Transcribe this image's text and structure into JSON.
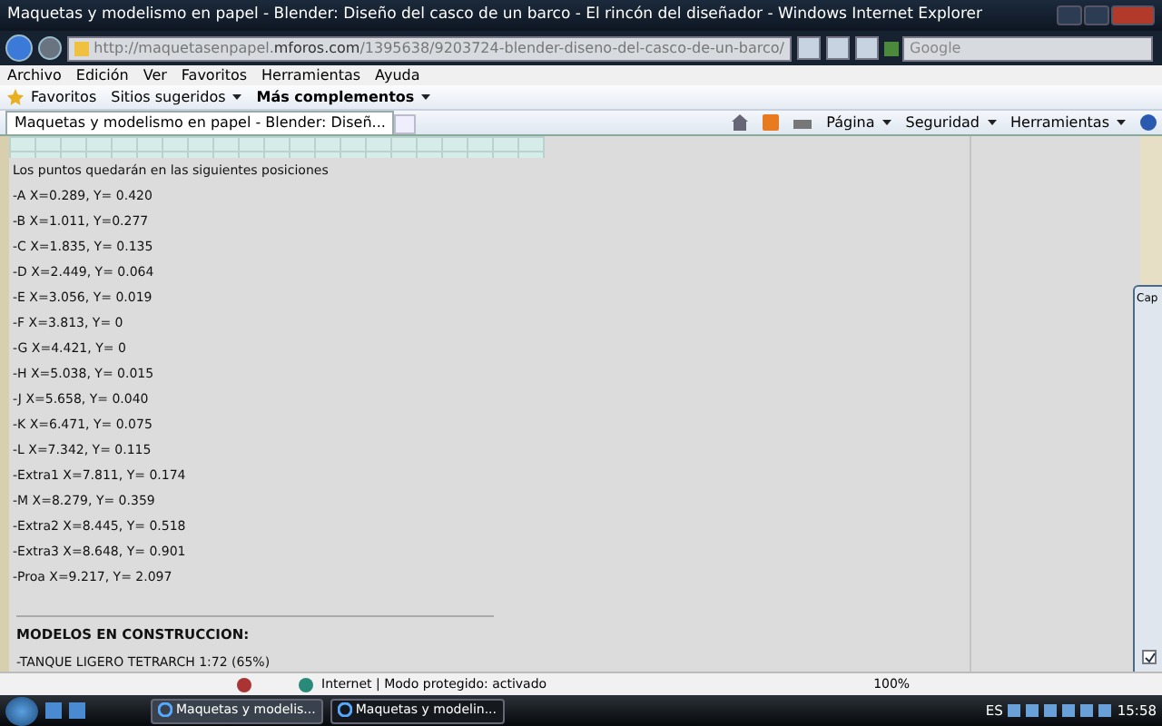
{
  "window": {
    "title": "Maquetas y modelismo en papel - Blender: Diseño del casco de un barco - El rincón del diseñador - Windows Internet Explorer"
  },
  "address_bar": {
    "url": "http://maquetasenpapel.**mforos.com**/1395638/9203724-blender-diseno-del-casco-de-un-barco/"
  },
  "search": {
    "placeholder": "Google"
  },
  "menu": [
    "Archivo",
    "Edición",
    "Ver",
    "Favoritos",
    "Herramientas",
    "Ayuda"
  ],
  "favorites_bar": {
    "label": "Favoritos",
    "items": [
      {
        "label": "Sitios sugeridos",
        "emphasized": false
      },
      {
        "label": "Más complementos",
        "emphasized": true
      }
    ]
  },
  "tabs": [
    {
      "label": "Maquetas y modelismo en papel - Blender: Diseñ...",
      "selected": true
    }
  ],
  "command_bar": [
    "Página",
    "Seguridad",
    "Herramientas"
  ],
  "content": {
    "intro": "Los puntos quedarán en las siguientes posiciones",
    "points": [
      "-A X=0.289, Y= 0.420",
      "-B X=1.011, Y=0.277",
      "-C X=1.835, Y= 0.135",
      "-D X=2.449, Y= 0.064",
      "-E X=3.056, Y= 0.019",
      "-F X=3.813, Y= 0",
      "-G X=4.421, Y= 0",
      "-H X=5.038, Y= 0.015",
      "-J X=5.658, Y= 0.040",
      "-K X=6.471, Y= 0.075",
      "-L X=7.342, Y= 0.115",
      "-Extra1 X=7.811, Y= 0.174",
      "-M X=8.279, Y= 0.359",
      "-Extra2 X=8.445, Y= 0.518",
      "-Extra3 X=8.648, Y= 0.901",
      "-Proa X=9.217, Y= 2.097"
    ],
    "section_heading": "MODELOS EN CONSTRUCCION:",
    "models": [
      {
        "prefix": "-",
        "link": "TANQUE LIGERO TETRARCH 1:72",
        "note": "(65%)"
      }
    ]
  },
  "dialog": {
    "title": "Cap",
    "checkbox": {
      "checked": true
    }
  },
  "status_bar": {
    "zone": "Internet | Modo protegido: activado",
    "zoom": "100%"
  },
  "taskbar": {
    "buttons": [
      {
        "label": "Maquetas y modelis...",
        "selected": false
      },
      {
        "label": "Maquetas y modelin...",
        "selected": true
      }
    ],
    "language": "ES",
    "clock": "15:58"
  }
}
